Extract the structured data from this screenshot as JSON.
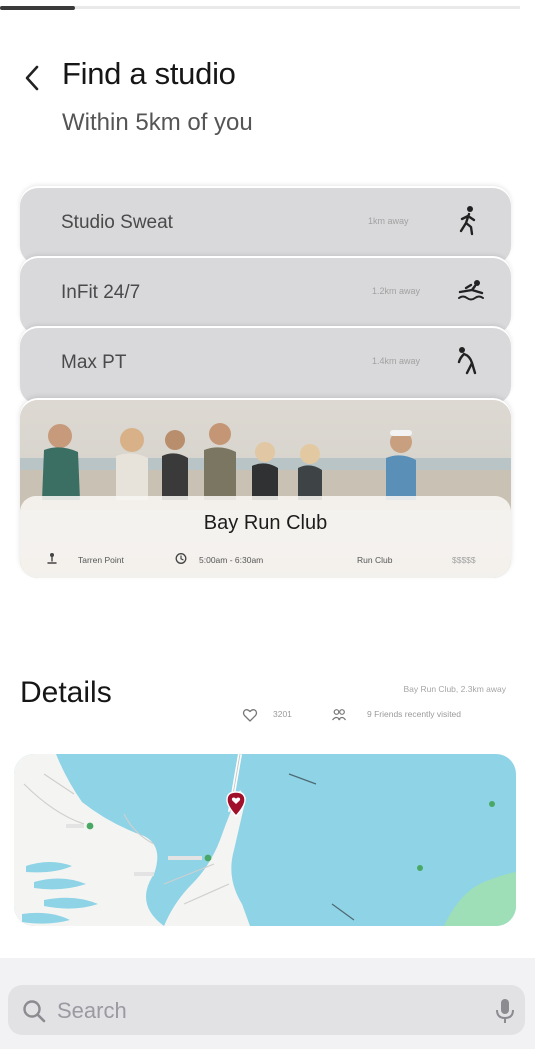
{
  "header": {
    "title": "Find a studio",
    "subtitle": "Within 5km of you",
    "progress": 0.14
  },
  "studios": [
    {
      "name": "Studio Sweat",
      "distance": "1km away",
      "icon": "running-person-icon"
    },
    {
      "name": "InFit 24/7",
      "distance": "1.2km away",
      "icon": "swimming-person-icon"
    },
    {
      "name": "Max PT",
      "distance": "1.4km away",
      "icon": "stretching-person-icon"
    }
  ],
  "featured": {
    "name": "Bay Run Club",
    "location": "Tarren Point",
    "time": "5:00am - 6:30am",
    "type": "Run Club",
    "price": "$$$$$",
    "image": "group-of-runners-photo"
  },
  "details": {
    "title": "Details",
    "subtitle": "Bay Run Club, 2.3km away",
    "likes": "3201",
    "friends": "9 Friends recently visited"
  },
  "map": {
    "pin": "location-pin-icon",
    "water_color": "#8ed3e6",
    "land_color": "#f4f4f2",
    "park_color": "#9edfb7",
    "pin_color": "#a1102a"
  },
  "search": {
    "placeholder": "Search",
    "value": ""
  }
}
